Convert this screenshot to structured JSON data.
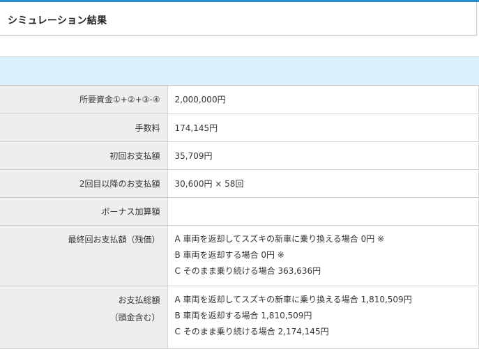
{
  "page": {
    "title": "シミュレーション結果"
  },
  "results": {
    "rows": [
      {
        "label": "所要資金①+②+③-④",
        "value": "2,000,000円"
      },
      {
        "label": "手数料",
        "value": "174,145円"
      },
      {
        "label": "初回お支払額",
        "value": "35,709円"
      },
      {
        "label": "2回目以降のお支払額",
        "value": "30,600円 × 58回"
      },
      {
        "label": "ボーナス加算額",
        "value": ""
      }
    ],
    "final_payment": {
      "label": "最終回お支払額（残価）",
      "lines": [
        "A 車両を返却してスズキの新車に乗り換える場合 0円 ※",
        "B 車両を返却する場合 0円 ※",
        "C そのまま乗り続ける場合 363,636円"
      ]
    },
    "total_payment": {
      "label": "お支払総額",
      "label_sub": "（頭金含む）",
      "lines": [
        "A 車両を返却してスズキの新車に乗り換える場合 1,810,509円",
        "B 車両を返却する場合 1,810,509円",
        "C そのまま乗り続ける場合 2,174,145円"
      ]
    }
  },
  "colors": {
    "accent": "#2a8ccd",
    "band": "#daf1fb",
    "label_bg": "#eeeeee"
  }
}
